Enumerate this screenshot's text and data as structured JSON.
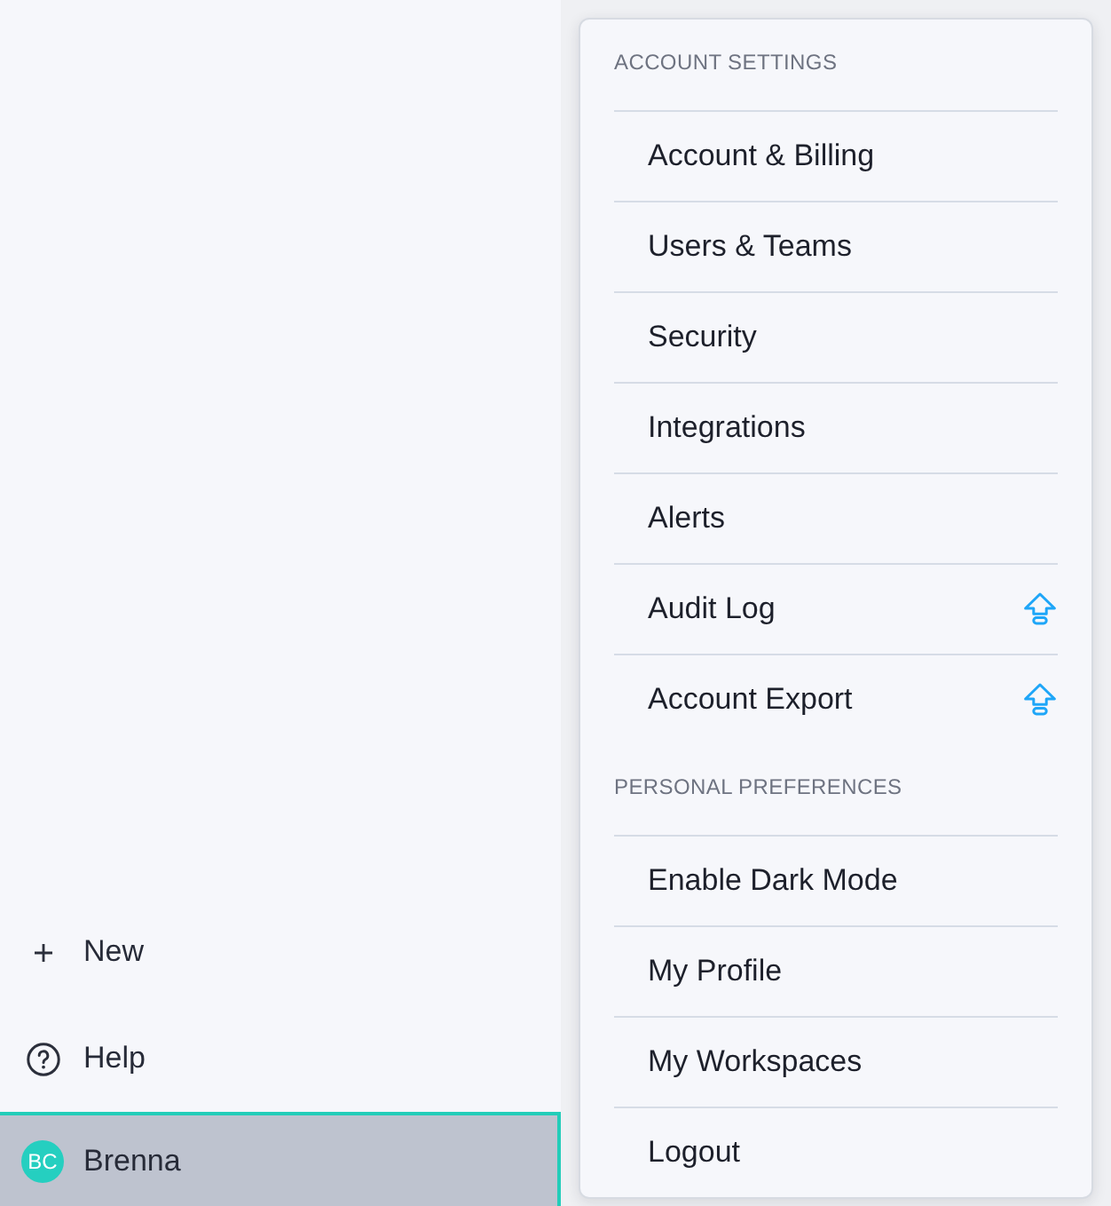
{
  "sidebar": {
    "items": [
      {
        "kind": "add",
        "label": "New",
        "selected": false
      },
      {
        "kind": "help",
        "label": "Help",
        "selected": false
      },
      {
        "kind": "account",
        "initials": "BC",
        "label": "Brenna",
        "selected": true
      }
    ]
  },
  "menu": {
    "sections": [
      {
        "title": "ACCOUNT SETTINGS",
        "items": [
          {
            "label": "Account & Billing",
            "upgrade": false
          },
          {
            "label": "Users & Teams",
            "upgrade": false
          },
          {
            "label": "Security",
            "upgrade": false
          },
          {
            "label": "Integrations",
            "upgrade": false
          },
          {
            "label": "Alerts",
            "upgrade": false
          },
          {
            "label": "Audit Log",
            "upgrade": true
          },
          {
            "label": "Account Export",
            "upgrade": true
          }
        ]
      },
      {
        "title": "PERSONAL PREFERENCES",
        "items": [
          {
            "label": "Enable Dark Mode",
            "upgrade": false
          },
          {
            "label": "My Profile",
            "upgrade": false
          },
          {
            "label": "My Workspaces",
            "upgrade": false
          },
          {
            "label": "Logout",
            "upgrade": false
          }
        ]
      }
    ]
  }
}
